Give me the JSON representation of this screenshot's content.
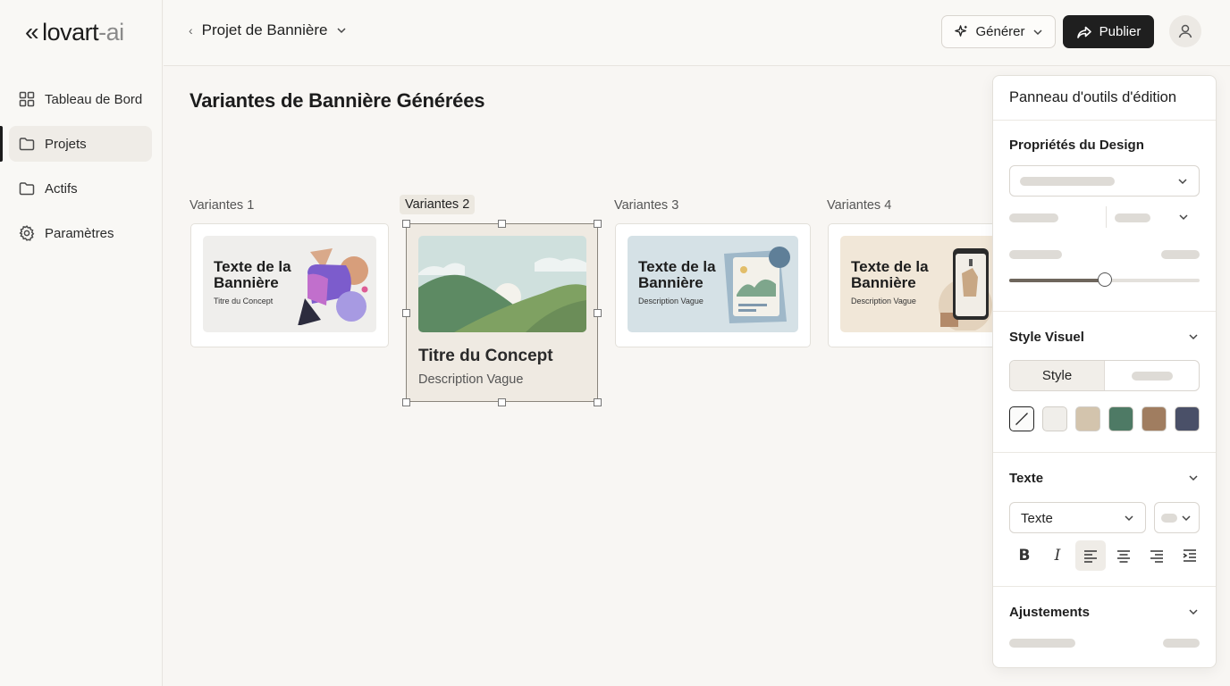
{
  "brand": {
    "chevrons": "«",
    "name_main": "lovart",
    "name_suffix": "-ai"
  },
  "sidebar": {
    "items": [
      {
        "label": "Tableau de Bord",
        "icon": "grid-icon",
        "active": false
      },
      {
        "label": "Projets",
        "icon": "folder-icon",
        "active": true
      },
      {
        "label": "Actifs",
        "icon": "folder-icon",
        "active": false
      },
      {
        "label": "Paramètres",
        "icon": "gear-icon",
        "active": false
      }
    ]
  },
  "header": {
    "project_name": "Projet de Bannière",
    "generate_label": "Générer",
    "publish_label": "Publier"
  },
  "main": {
    "title": "Variantes de Bannière Générées",
    "variants": [
      {
        "label": "Variantes 1",
        "thumb_title": "Texte de la Bannière",
        "thumb_sub": "Titre du Concept"
      },
      {
        "label": "Variantes 2",
        "concept_title": "Titre du Concept",
        "concept_desc": "Description Vague",
        "selected": true
      },
      {
        "label": "Variantes 3",
        "thumb_title": "Texte de la Bannière",
        "thumb_sub": "Description Vague"
      },
      {
        "label": "Variantes 4",
        "thumb_title": "Texte de la Bannière",
        "thumb_sub": "Description Vague"
      }
    ]
  },
  "panel": {
    "title": "Panneau d'outils d'édition",
    "design": {
      "title": "Propriétés du Design",
      "slider_value": 0.5
    },
    "visual": {
      "title": "Style Visuel",
      "style_label": "Style",
      "swatches": [
        "#f0eeea",
        "#d3c4ad",
        "#4e7a65",
        "#a07d60",
        "#4a5068"
      ]
    },
    "text": {
      "title": "Texte",
      "font_select": "Texte",
      "bold": "B",
      "italic": "I"
    },
    "adjust": {
      "title": "Ajustements"
    }
  }
}
